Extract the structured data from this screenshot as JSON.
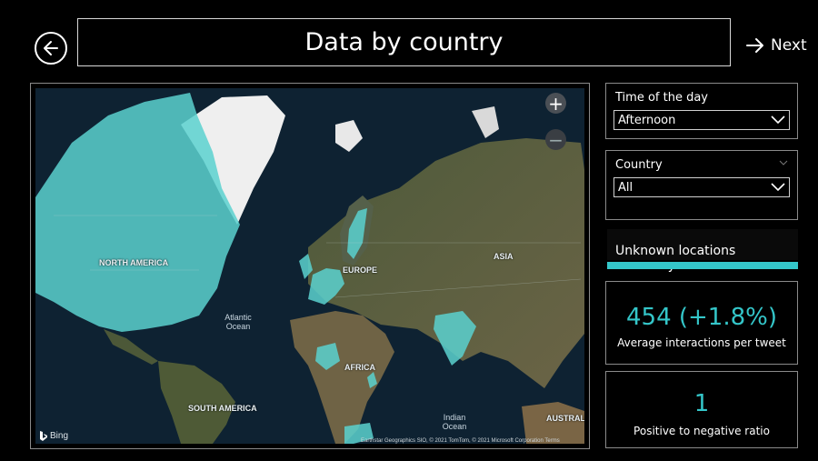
{
  "header": {
    "title": "Data by country",
    "next_label": "Next"
  },
  "map": {
    "labels": {
      "north_america": "NORTH AMERICA",
      "europe": "EUROPE",
      "asia": "ASIA",
      "africa": "AFRICA",
      "south_america": "SOUTH AMERICA",
      "australia": "AUSTRALIA",
      "atlantic_ocean": "Atlantic Ocean",
      "indian_ocean": "Indian Ocean"
    },
    "provider": "Bing",
    "attribution": "Earthstar Geographics SIO, © 2021 TomTom, © 2021 Microsoft Corporation  Terms",
    "highlight_color": "#5ad1cf",
    "zoom_in_icon": "plus-icon",
    "zoom_out_icon": "minus-icon"
  },
  "filters": {
    "time_of_day": {
      "label": "Time of the day",
      "value": "Afternoon"
    },
    "country": {
      "label": "Country",
      "value": "All"
    }
  },
  "summary": {
    "title": "Unknown locations summary",
    "accent_color": "#34c6c9",
    "avg_interactions": {
      "value": "454 (+1.8%)",
      "caption": "Average interactions per tweet"
    },
    "ratio": {
      "value": "1",
      "caption": "Positive to negative ratio"
    }
  }
}
